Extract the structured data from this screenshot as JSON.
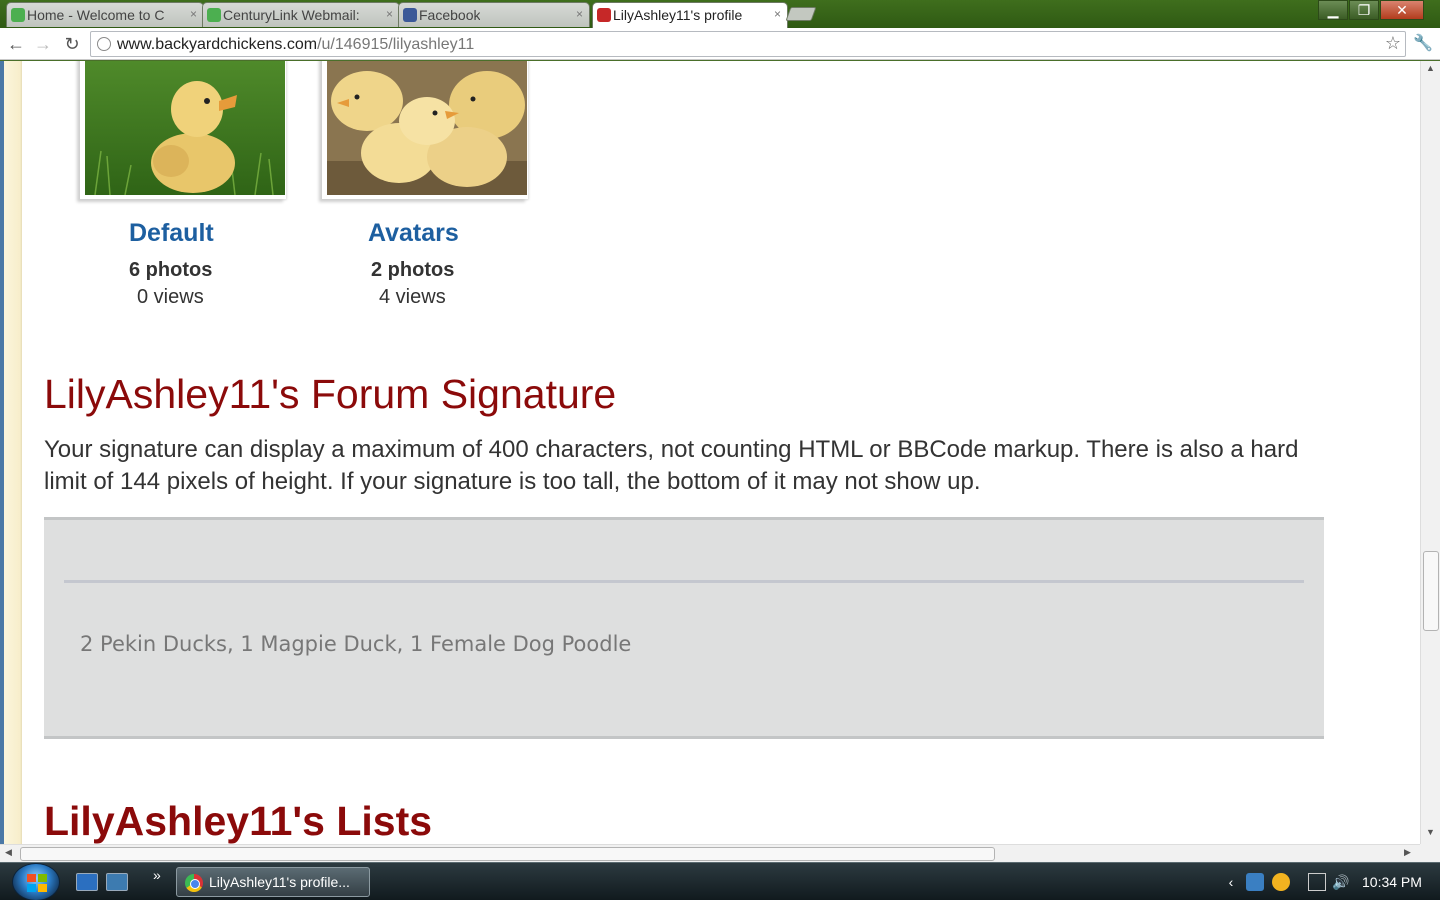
{
  "browser": {
    "tabs": [
      {
        "title": "Home - Welcome to C",
        "icon_color": "#4caf50",
        "active": false
      },
      {
        "title": "CenturyLink Webmail:",
        "icon_color": "#4caf50",
        "active": false
      },
      {
        "title": "Facebook",
        "icon_color": "#3b5998",
        "active": false
      },
      {
        "title": "LilyAshley11's profile",
        "icon_color": "#c62828",
        "active": true
      }
    ],
    "url_host": "www.backyardchickens.com",
    "url_path": "/u/146915/lilyashley11"
  },
  "albums": [
    {
      "title": "Default",
      "photos": "6 photos",
      "views": "0 views"
    },
    {
      "title": "Avatars",
      "photos": "2 photos",
      "views": "4 views"
    }
  ],
  "signature": {
    "heading": "LilyAshley11's Forum Signature",
    "description": "Your signature can display a maximum of 400 characters, not counting HTML or BBCode markup. There is also a hard limit of 144 pixels of height. If your signature is too tall, the bottom of it may not show up.",
    "text": "2 Pekin Ducks, 1 Magpie Duck, 1 Female Dog Poodle"
  },
  "lists": {
    "heading": "LilyAshley11's Lists"
  },
  "taskbar": {
    "task_label": "LilyAshley11's profile...",
    "clock": "10:34 PM"
  },
  "colors": {
    "heading": "#8b0a0a",
    "album_title": "#1d5fa0",
    "signature_box": "#dedfdf"
  }
}
